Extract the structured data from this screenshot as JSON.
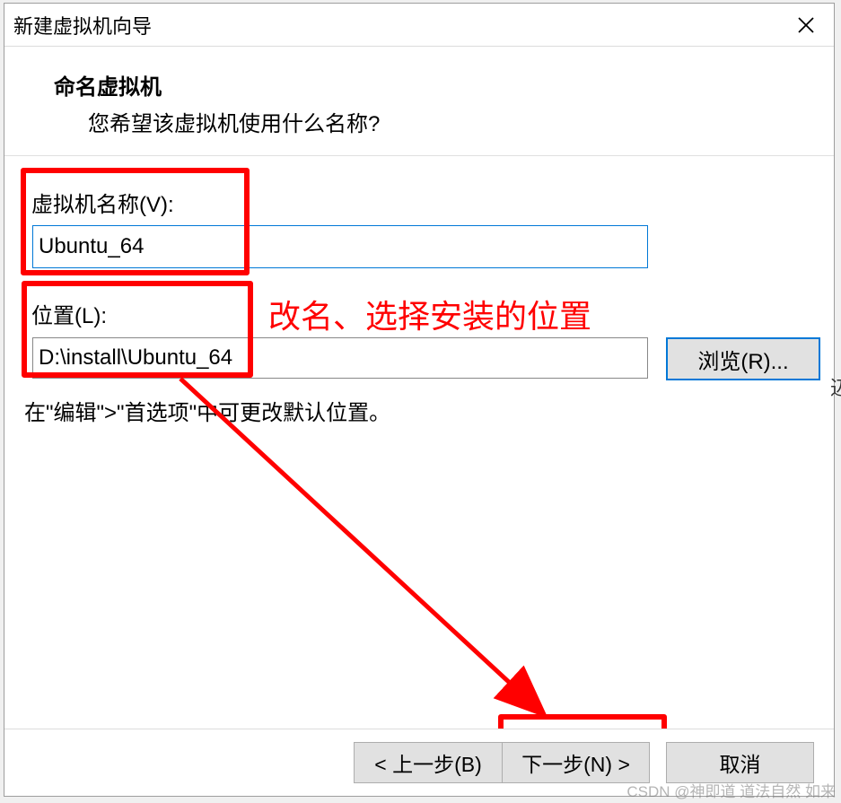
{
  "titlebar": {
    "title": "新建虚拟机向导"
  },
  "header": {
    "title": "命名虚拟机",
    "subtitle": "您希望该虚拟机使用什么名称?"
  },
  "fields": {
    "vm_name_label": "虚拟机名称(V):",
    "vm_name_value": "Ubuntu_64",
    "location_label": "位置(L):",
    "location_value": "D:\\install\\Ubuntu_64",
    "browse_label": "浏览(R)..."
  },
  "hint": "在\"编辑\">\"首选项\"中可更改默认位置。",
  "annotation": "改名、选择安装的位置",
  "footer": {
    "back": "< 上一步(B)",
    "next": "下一步(N) >",
    "cancel": "取消"
  },
  "watermark": "CSDN @神即道 道法自然 如来"
}
